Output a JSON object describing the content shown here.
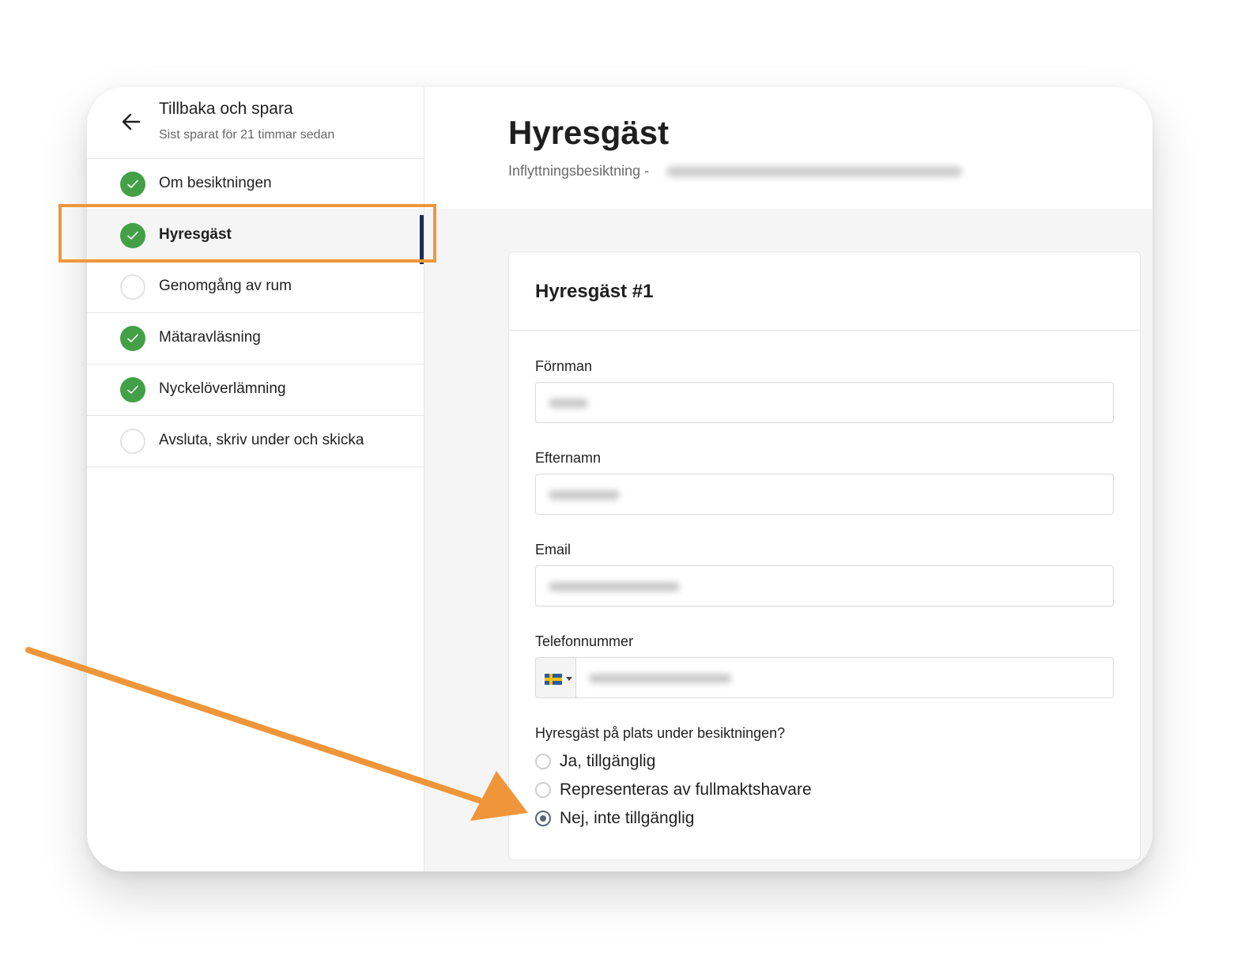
{
  "sidebar": {
    "back_title": "Tillbaka och spara",
    "back_subtitle": "Sist sparat för 21 timmar sedan",
    "items": [
      {
        "label": "Om besiktningen",
        "status": "done"
      },
      {
        "label": "Hyresgäst",
        "status": "done",
        "active": true
      },
      {
        "label": "Genomgång av rum",
        "status": "todo"
      },
      {
        "label": "Mätaravläsning",
        "status": "done"
      },
      {
        "label": "Nyckelöverlämning",
        "status": "done"
      },
      {
        "label": "Avsluta, skriv under och skicka",
        "status": "todo"
      }
    ]
  },
  "main": {
    "title": "Hyresgäst",
    "subtitle": "Inflyttningsbesiktning -",
    "card": {
      "title": "Hyresgäst #1",
      "fields": {
        "first_name_label": "Förnman",
        "last_name_label": "Efternamn",
        "email_label": "Email",
        "phone_label": "Telefonnummer"
      },
      "phone_country_icon": "sweden-flag-icon",
      "question": "Hyresgäst på plats under besiktningen?",
      "options": [
        {
          "label": "Ja, tillgänglig",
          "checked": false
        },
        {
          "label": "Representeras av fullmaktshavare",
          "checked": false
        },
        {
          "label": "Nej, inte tillgänglig",
          "checked": true
        }
      ]
    }
  },
  "colors": {
    "done": "#43a047",
    "active_bar": "#1d2a55",
    "annotation": "#f0963a"
  }
}
